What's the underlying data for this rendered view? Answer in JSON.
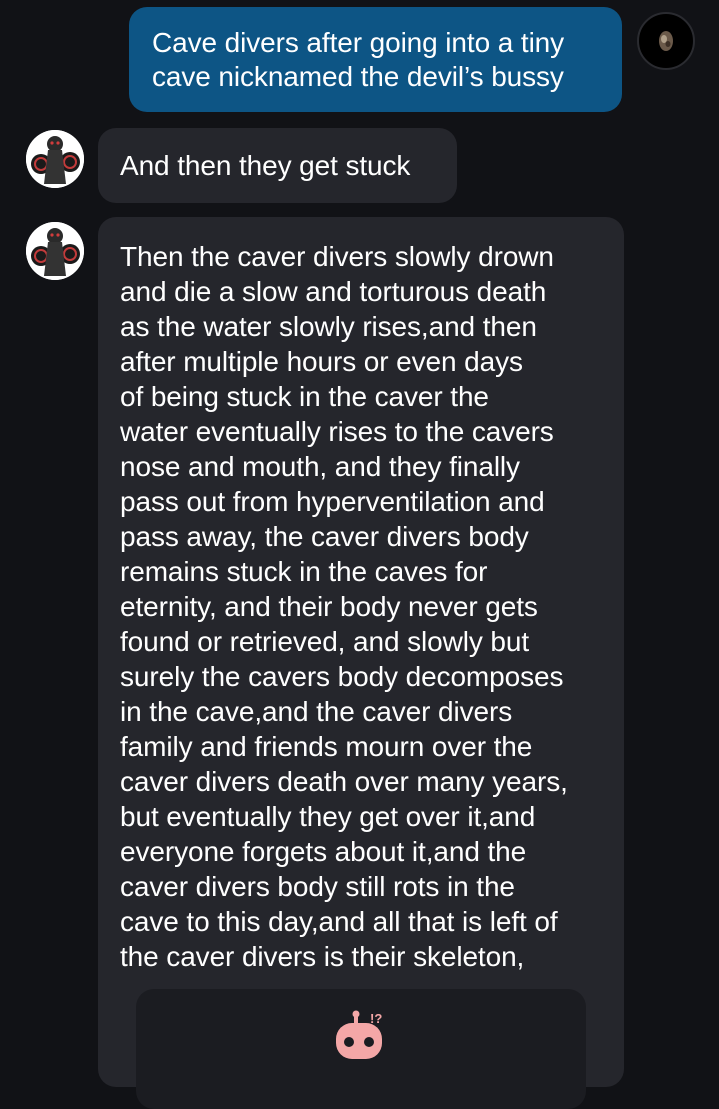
{
  "user_message": {
    "lines": [
      "Cave divers after going into a tiny",
      "cave nicknamed the devil’s bussy"
    ]
  },
  "bot_messages": [
    {
      "text": "And then they get stuck"
    },
    {
      "lines": [
        "Then the caver divers slowly drown",
        "and die a slow and torturous death",
        "as the water slowly rises,and then",
        "after multiple hours or even days",
        "of being stuck in the caver the",
        "water eventually rises to the cavers",
        "nose and mouth, and they finally",
        "pass out from hyperventilation and",
        "pass away, the caver divers body",
        "remains stuck in the caves for",
        "eternity, and their body never gets",
        "found or retrieved, and slowly but",
        "surely the cavers body decomposes",
        "in the cave,and the caver divers",
        "family and friends mourn over the",
        "caver divers death over many years,",
        "but eventually they get over it,and",
        "everyone forgets about it,and the",
        "caver divers body still rots in the",
        "cave to this day,and all that is left of",
        "the caver divers is their skeleton,"
      ]
    }
  ],
  "embed_card": {
    "icon": "robot-interrobang-icon",
    "badge_text": "!?"
  },
  "colors": {
    "background": "#111216",
    "user_bubble": "#0d5585",
    "bot_bubble": "#25262c",
    "robot_icon": "#f4a7a7"
  }
}
